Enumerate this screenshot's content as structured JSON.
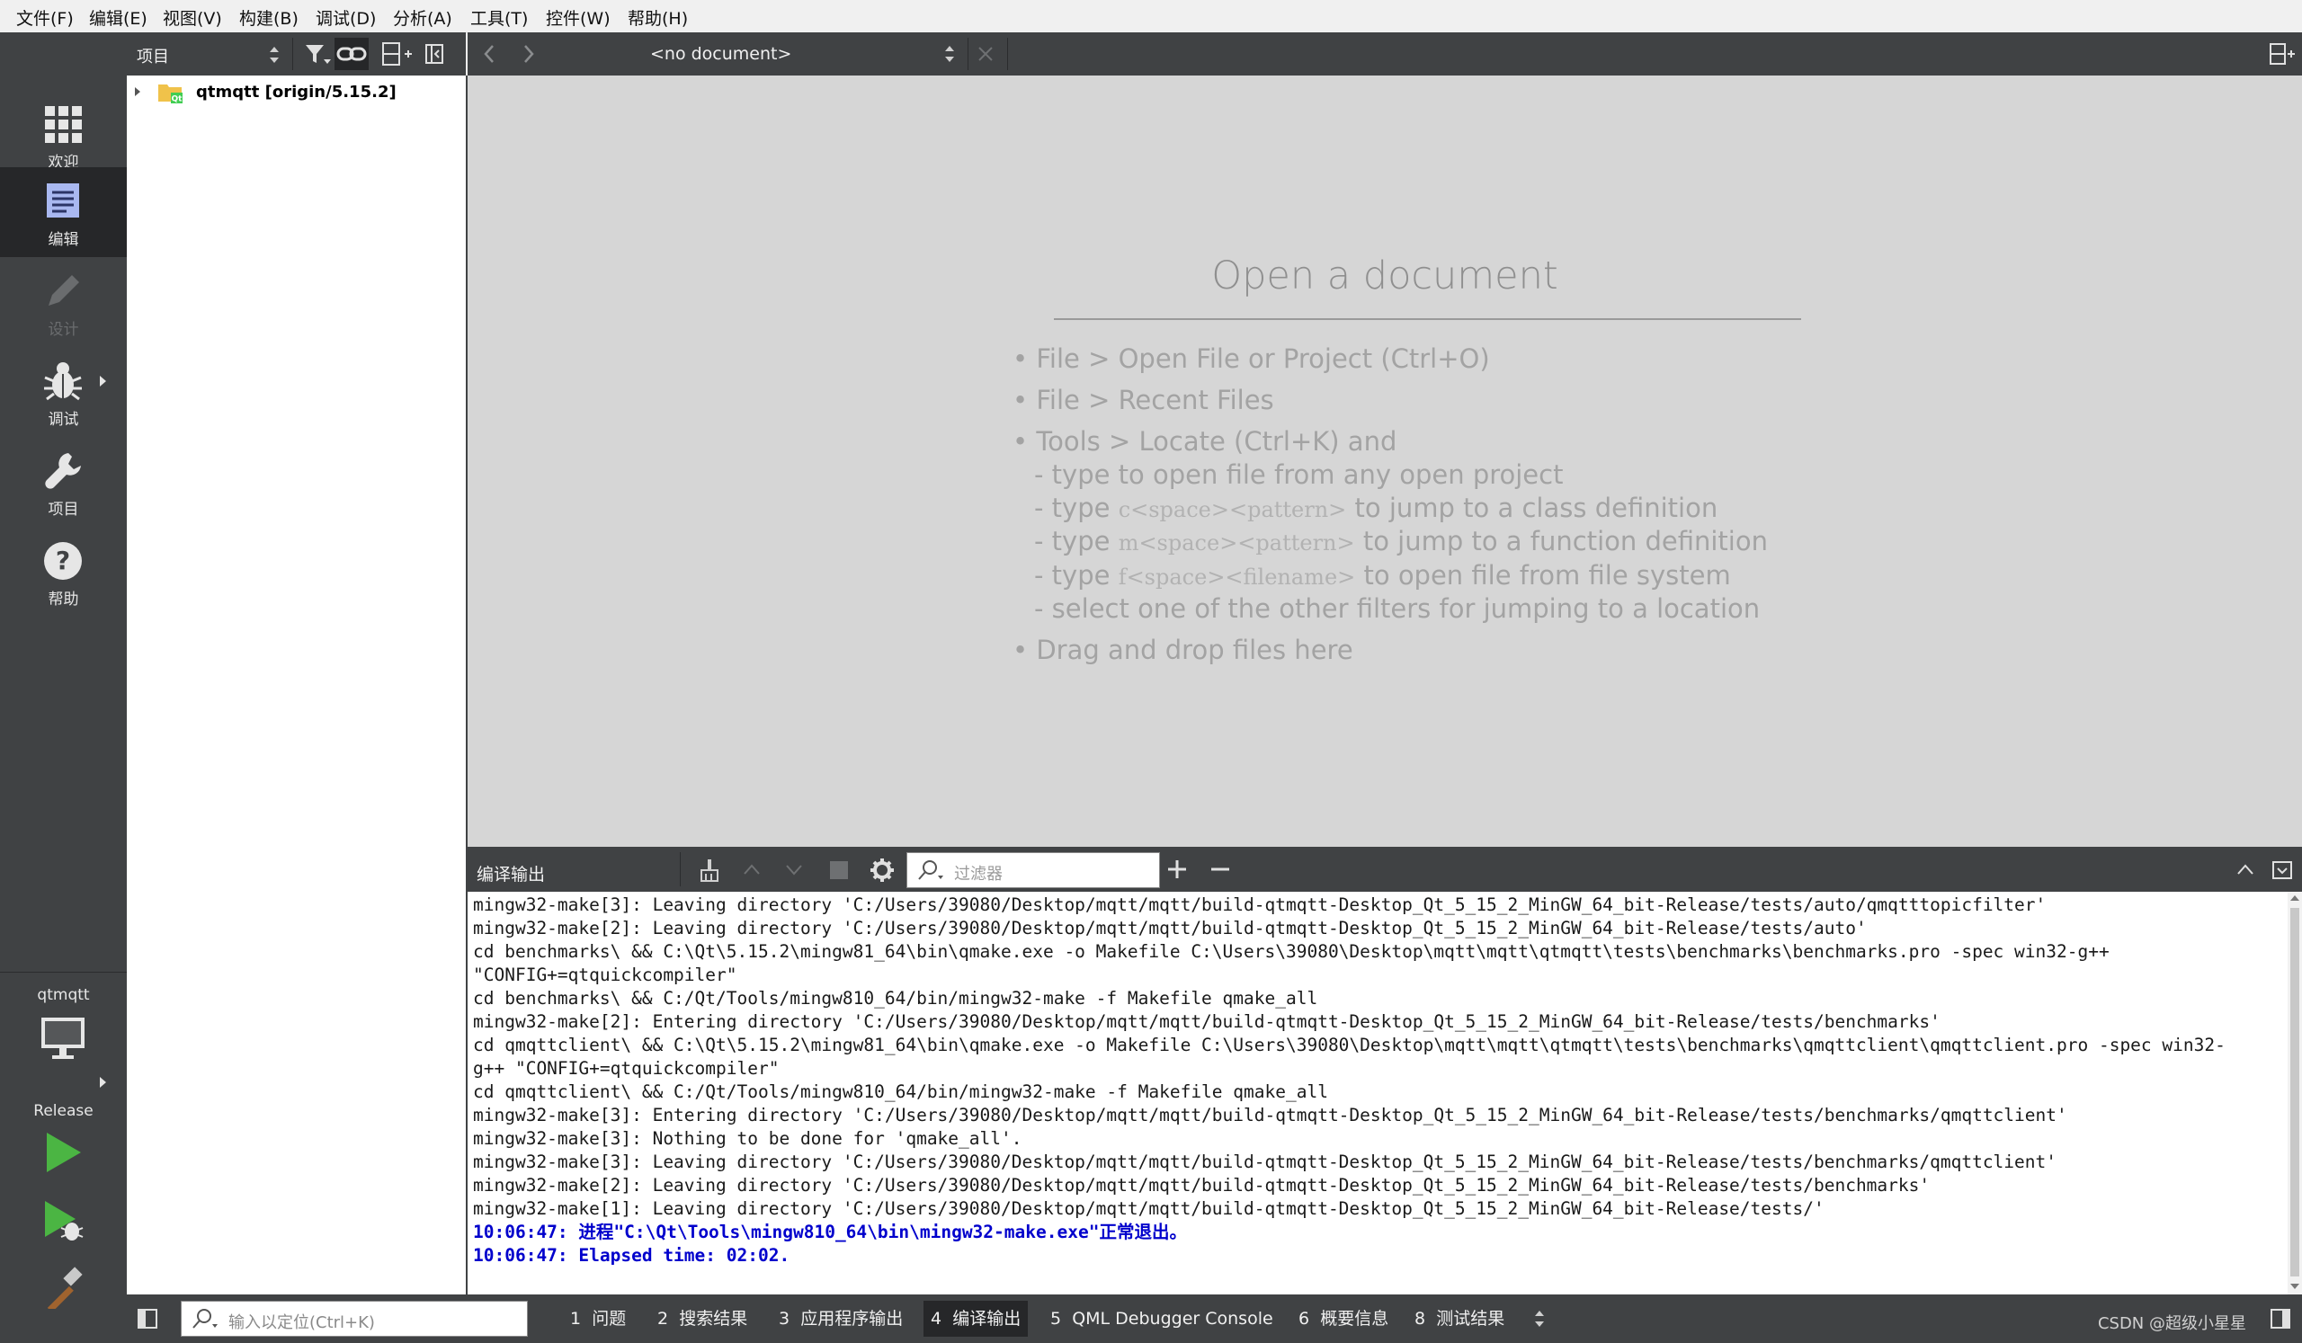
{
  "menubar": [
    "文件(F)",
    "编辑(E)",
    "视图(V)",
    "构建(B)",
    "调试(D)",
    "分析(A)",
    "工具(T)",
    "控件(W)",
    "帮助(H)"
  ],
  "modes": [
    {
      "label": "欢迎",
      "icon": "welcome-grid-icon",
      "state": "normal"
    },
    {
      "label": "编辑",
      "icon": "edit-document-icon",
      "state": "active"
    },
    {
      "label": "设计",
      "icon": "design-pencil-icon",
      "state": "disabled"
    },
    {
      "label": "调试",
      "icon": "debug-bug-icon",
      "state": "normal"
    },
    {
      "label": "项目",
      "icon": "wrench-icon",
      "state": "normal"
    },
    {
      "label": "帮助",
      "icon": "help-question-icon",
      "state": "normal"
    }
  ],
  "kit": {
    "project": "qtmqtt",
    "config": "Release",
    "icon": "monitor-icon"
  },
  "actions": {
    "run": "run-icon",
    "debug": "debug-run-icon",
    "build": "build-hammer-icon"
  },
  "navigation": {
    "title": "项目",
    "tree_item": "qtmqtt [origin/5.15.2]"
  },
  "editor": {
    "document": "<no document>",
    "welcome_title": "Open a document",
    "hints": {
      "h1": "• File > Open File or Project (Ctrl+O)",
      "h2": "• File > Recent Files",
      "h3": "• Tools > Locate (Ctrl+K) and",
      "h4": "- type to open file from any open project",
      "h5a": "- type ",
      "h5code": "c<space><pattern>",
      "h5b": " to jump to a class definition",
      "h6a": "- type ",
      "h6code": "m<space><pattern>",
      "h6b": " to jump to a function definition",
      "h7a": "- type ",
      "h7code": "f<space><filename>",
      "h7b": " to open file from file system",
      "h8": "- select one of the other filters for jumping to a location",
      "h9": "• Drag and drop files here"
    }
  },
  "output": {
    "title": "编译输出",
    "filter_placeholder": "过滤器",
    "lines": [
      "mingw32-make[3]: Leaving directory 'C:/Users/39080/Desktop/mqtt/mqtt/build-qtmqtt-Desktop_Qt_5_15_2_MinGW_64_bit-Release/tests/auto/qmqtttopicfilter'",
      "mingw32-make[2]: Leaving directory 'C:/Users/39080/Desktop/mqtt/mqtt/build-qtmqtt-Desktop_Qt_5_15_2_MinGW_64_bit-Release/tests/auto'",
      "cd benchmarks\\ && C:\\Qt\\5.15.2\\mingw81_64\\bin\\qmake.exe -o Makefile C:\\Users\\39080\\Desktop\\mqtt\\mqtt\\qtmqtt\\tests\\benchmarks\\benchmarks.pro -spec win32-g++",
      "\"CONFIG+=qtquickcompiler\"",
      "cd benchmarks\\ && C:/Qt/Tools/mingw810_64/bin/mingw32-make -f Makefile qmake_all",
      "mingw32-make[2]: Entering directory 'C:/Users/39080/Desktop/mqtt/mqtt/build-qtmqtt-Desktop_Qt_5_15_2_MinGW_64_bit-Release/tests/benchmarks'",
      "cd qmqttclient\\ && C:\\Qt\\5.15.2\\mingw81_64\\bin\\qmake.exe -o Makefile C:\\Users\\39080\\Desktop\\mqtt\\mqtt\\qtmqtt\\tests\\benchmarks\\qmqttclient\\qmqttclient.pro -spec win32-",
      "g++ \"CONFIG+=qtquickcompiler\"",
      "cd qmqttclient\\ && C:/Qt/Tools/mingw810_64/bin/mingw32-make -f Makefile qmake_all",
      "mingw32-make[3]: Entering directory 'C:/Users/39080/Desktop/mqtt/mqtt/build-qtmqtt-Desktop_Qt_5_15_2_MinGW_64_bit-Release/tests/benchmarks/qmqttclient'",
      "mingw32-make[3]: Nothing to be done for 'qmake_all'.",
      "mingw32-make[3]: Leaving directory 'C:/Users/39080/Desktop/mqtt/mqtt/build-qtmqtt-Desktop_Qt_5_15_2_MinGW_64_bit-Release/tests/benchmarks/qmqttclient'",
      "mingw32-make[2]: Leaving directory 'C:/Users/39080/Desktop/mqtt/mqtt/build-qtmqtt-Desktop_Qt_5_15_2_MinGW_64_bit-Release/tests/benchmarks'",
      "mingw32-make[1]: Leaving directory 'C:/Users/39080/Desktop/mqtt/mqtt/build-qtmqtt-Desktop_Qt_5_15_2_MinGW_64_bit-Release/tests/'"
    ],
    "status_lines": [
      "10:06:47: 进程\"C:\\Qt\\Tools\\mingw810_64\\bin\\mingw32-make.exe\"正常退出。",
      "10:06:47: Elapsed time: 02:02."
    ]
  },
  "statusbar": {
    "locator_placeholder": "输入以定位(Ctrl+K)",
    "tabs": [
      {
        "num": "1",
        "label": "问题"
      },
      {
        "num": "2",
        "label": "搜索结果"
      },
      {
        "num": "3",
        "label": "应用程序输出"
      },
      {
        "num": "4",
        "label": "编译输出",
        "active": true
      },
      {
        "num": "5",
        "label": "QML Debugger Console"
      },
      {
        "num": "6",
        "label": "概要信息"
      },
      {
        "num": "8",
        "label": "测试结果"
      }
    ],
    "watermark": "CSDN @超级小星星"
  },
  "colors": {
    "sidebar": "#404244",
    "active_mode": "#262729",
    "editor_bg": "#d6d6d6",
    "run_green": "#4bb543",
    "status_blue": "#0000cc"
  }
}
